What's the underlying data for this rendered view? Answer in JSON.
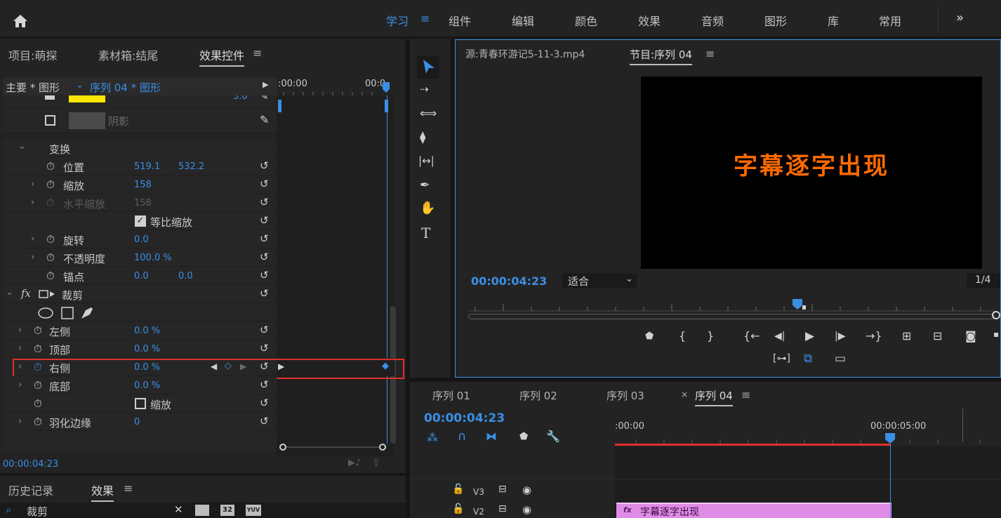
{
  "topbar": {
    "workspaces": [
      "学习",
      "组件",
      "编辑",
      "颜色",
      "效果",
      "音频",
      "图形",
      "库",
      "常用"
    ],
    "active_index": 0,
    "more": "»",
    "menu_glyph": "≡"
  },
  "left": {
    "tabs": [
      "项目:萌探",
      "素材箱:结尾",
      "效果控件"
    ],
    "master_label": "主要 * 图形",
    "clip_label": "序列 04 * 图形",
    "time_start": ":00:00",
    "time_end": "00:0",
    "shadow_label": "阴影",
    "stroke_value": "3.0",
    "transform_label": "变换",
    "position": {
      "label": "位置",
      "x": "519.1",
      "y": "532.2"
    },
    "scale": {
      "label": "缩放",
      "value": "158"
    },
    "hscale": {
      "label": "水平缩放",
      "value": "158"
    },
    "uniform": "等比缩放",
    "rotation": {
      "label": "旋转",
      "value": "0.0"
    },
    "opacity": {
      "label": "不透明度",
      "value": "100.0 %"
    },
    "anchor": {
      "label": "锚点",
      "x": "0.0",
      "y": "0.0"
    },
    "crop_label": "裁剪",
    "crop_left": {
      "label": "左侧",
      "value": "0.0 %"
    },
    "crop_top": {
      "label": "顶部",
      "value": "0.0 %"
    },
    "crop_right": {
      "label": "右侧",
      "value": "0.0 %"
    },
    "crop_bottom": {
      "label": "底部",
      "value": "0.0 %"
    },
    "crop_zoom": "缩放",
    "feather": {
      "label": "羽化边缘",
      "value": "0"
    },
    "current_time": "00:00:04:23",
    "fx_glyph": "fx"
  },
  "effects": {
    "tabs": [
      "历史记录",
      "效果"
    ],
    "search_value": "裁剪",
    "badges": [
      "32",
      "YUV"
    ]
  },
  "monitor": {
    "source_tab": "源:青春环游记5-11-3.mp4",
    "program_tab": "节目:序列 04",
    "title_text": "字幕逐字出现",
    "timecode": "00:00:04:23",
    "fit": "适合",
    "resolution": "1/4"
  },
  "timeline": {
    "tabs": [
      "序列 01",
      "序列 02",
      "序列 03",
      "序列 04"
    ],
    "close_glyph": "×",
    "timecode": "00:00:04:23",
    "ruler_start": ":00:00",
    "ruler_mark": "00:00:05:00",
    "tracks": [
      "V3",
      "V2"
    ],
    "clip_label": "字幕逐字出现",
    "clip_fx": "fx"
  },
  "colors": {
    "accent": "#3a8fe6",
    "highlight_box": "#e0302a",
    "title_text": "#ff6a00",
    "clip": "#e08ce6"
  }
}
